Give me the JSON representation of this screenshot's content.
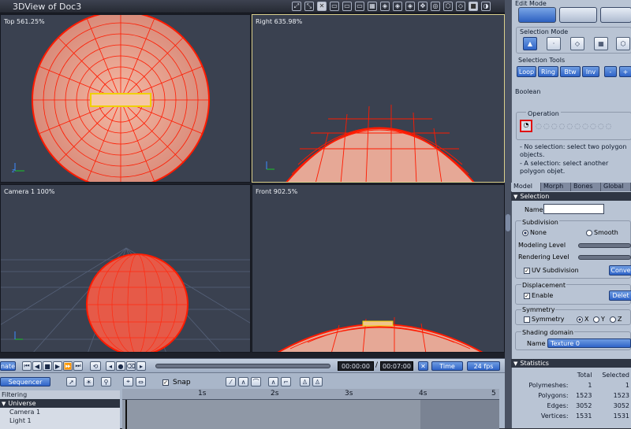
{
  "window": {
    "title": "3DView of Doc3"
  },
  "toolbar_icons": [
    "expand-icon",
    "collapse-icon",
    "eye-icon",
    "layout1-icon",
    "layout2-icon",
    "layout3-icon",
    "layout4-icon",
    "camera-icon",
    "perspective-icon",
    "top-icon",
    "front-icon",
    "side-icon",
    "sphere-icon",
    "cube-icon",
    "shaded-icon",
    "colors-icon"
  ],
  "viewports": {
    "top": {
      "label": "Top 561.25%"
    },
    "right": {
      "label": "Right 635.98%"
    },
    "camera": {
      "label": "Camera 1 100%"
    },
    "front": {
      "label": "Front 902.5%"
    }
  },
  "timeline": {
    "animate_label": "nate",
    "current_time": "00:00:00",
    "separator": "/",
    "end_time": "00:07:00",
    "time_unit": "Time",
    "fps": "24 fps",
    "sequencer": "Sequencer",
    "filtering": "Filtering",
    "snap": "Snap",
    "ruler": [
      "1s",
      "2s",
      "3s",
      "4s",
      "5"
    ],
    "tracks": [
      "Universe",
      "Camera 1",
      "Light 1"
    ]
  },
  "panel": {
    "edit_mode_label": "Edit Mode",
    "selection_mode_label": "Selection Mode",
    "selection_tools_label": "Selection Tools",
    "tools": [
      "Loop",
      "Ring",
      "Btw",
      "Inv",
      "-",
      "+"
    ],
    "boolean_label": "Boolean",
    "operation_label": "Operation",
    "hint1": "- No selection: select two polygon objects.",
    "hint2": "- A selection: select another polygon objet.",
    "tabs": [
      "Model",
      "Morph",
      "Bones",
      "Global"
    ],
    "selection_header": "Selection",
    "name_label": "Name",
    "name_value": "",
    "subdivision_label": "Subdivision",
    "none_label": "None",
    "smooth_label": "Smooth",
    "modeling_level": "Modeling Level",
    "rendering_level": "Rendering Level",
    "uv_subdivision": "UV Subdivision",
    "convert_btn": "Conve",
    "displacement_label": "Displacement",
    "enable_label": "Enable",
    "delete_btn": "Delet",
    "symmetry_label": "Symmetry",
    "symmetry_chk": "Symmetry",
    "axis_x": "X",
    "axis_y": "Y",
    "axis_z": "Z",
    "shading_domain_label": "Shading domain",
    "shading_name_label": "Name",
    "shading_value": "Texture 0",
    "statistics_header": "Statistics",
    "stat_cols": [
      "Total",
      "Selected"
    ],
    "stats": [
      {
        "label": "Polymeshes:",
        "total": "1",
        "selected": "1"
      },
      {
        "label": "Polygons:",
        "total": "1523",
        "selected": "1523"
      },
      {
        "label": "Edges:",
        "total": "3052",
        "selected": "3052"
      },
      {
        "label": "Vertices:",
        "total": "1531",
        "selected": "1531"
      }
    ]
  }
}
